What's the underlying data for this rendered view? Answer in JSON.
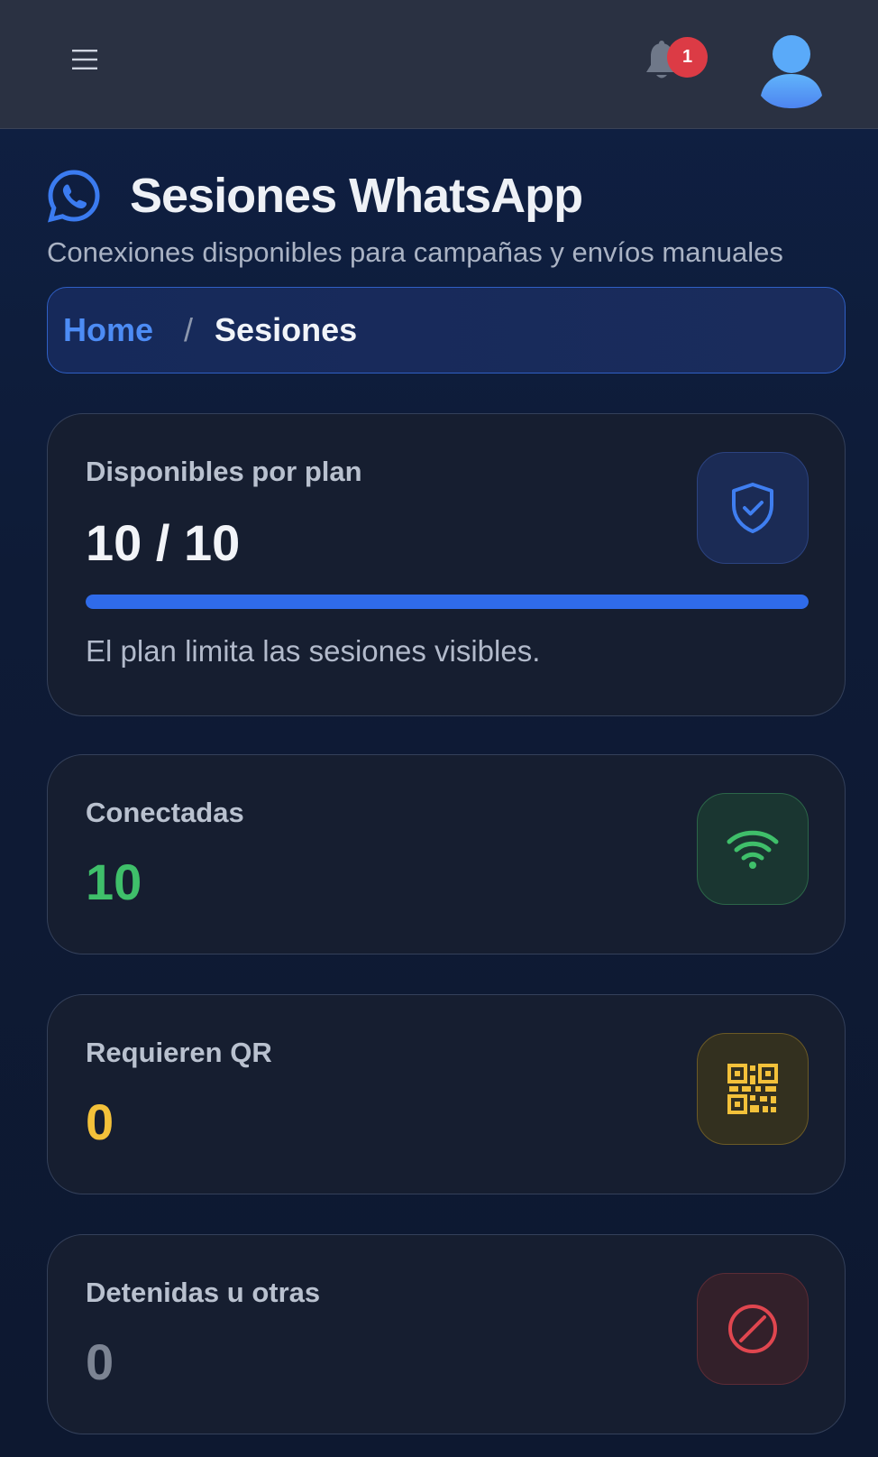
{
  "topbar": {
    "menu_icon": "hamburger-menu-icon",
    "notifications": {
      "icon": "bell-icon",
      "badge_count": "1",
      "badge_color": "#dc3b45"
    },
    "avatar_icon": "user-avatar-icon"
  },
  "header": {
    "icon": "whatsapp-icon",
    "title": "Sesiones WhatsApp",
    "subtitle": "Conexiones disponibles para campañas y envíos manuales"
  },
  "breadcrumb": {
    "home": "Home",
    "separator": "/",
    "current": "Sesiones"
  },
  "cards": {
    "plan": {
      "label": "Disponibles por plan",
      "value": "10 / 10",
      "progress": 1.0,
      "note": "El plan limita las sesiones visibles.",
      "icon": "shield-check-icon",
      "color": "#3f7ef0"
    },
    "connected": {
      "label": "Conectadas",
      "value": "10",
      "icon": "wifi-icon",
      "color": "#3fbf6a"
    },
    "qr": {
      "label": "Requieren QR",
      "value": "0",
      "icon": "qr-code-icon",
      "color": "#f3c13a"
    },
    "stopped": {
      "label": "Detenidas u otras",
      "value": "0",
      "icon": "ban-icon",
      "color": "#e0464f"
    }
  }
}
